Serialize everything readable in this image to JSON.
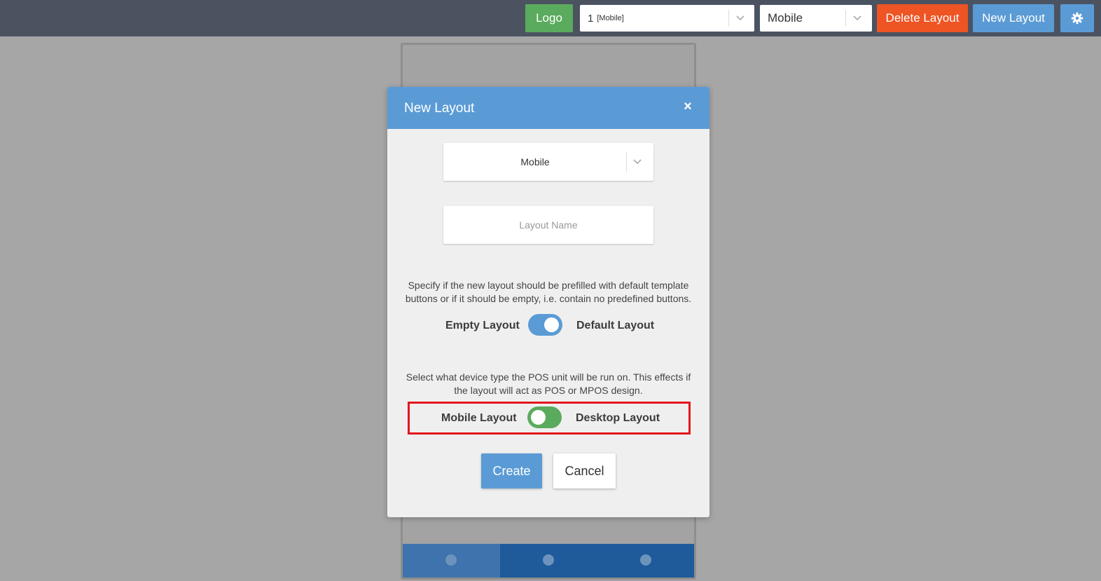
{
  "toolbar": {
    "logo_label": "Logo",
    "layout_select": {
      "value": "1",
      "tag": "[Mobile]"
    },
    "device_select": {
      "value": "Mobile"
    },
    "delete_label": "Delete Layout",
    "new_label": "New Layout",
    "settings_icon": "gear-icon"
  },
  "colors": {
    "topbar": "#4b5361",
    "logo": "#5aab5d",
    "delete": "#ef5424",
    "primary": "#5b9bd5",
    "toggle_green": "#5aab5d",
    "highlight": "#e3161e"
  },
  "modal": {
    "title": "New Layout",
    "close_label": "×",
    "device_select": {
      "value": "Mobile"
    },
    "layout_name": {
      "value": "",
      "placeholder": "Layout Name"
    },
    "prefill_description": "Specify if the new layout should be prefilled with default template buttons or if it should be empty, i.e. contain no predefined buttons.",
    "prefill_toggle": {
      "left_label": "Empty Layout",
      "right_label": "Default Layout",
      "selected": "Default Layout"
    },
    "device_description": "Select what device type the POS unit will be run on. This effects if the layout will act as POS or MPOS design.",
    "device_toggle": {
      "left_label": "Mobile Layout",
      "right_label": "Desktop Layout",
      "selected": "Mobile Layout"
    },
    "create_label": "Create",
    "cancel_label": "Cancel"
  }
}
